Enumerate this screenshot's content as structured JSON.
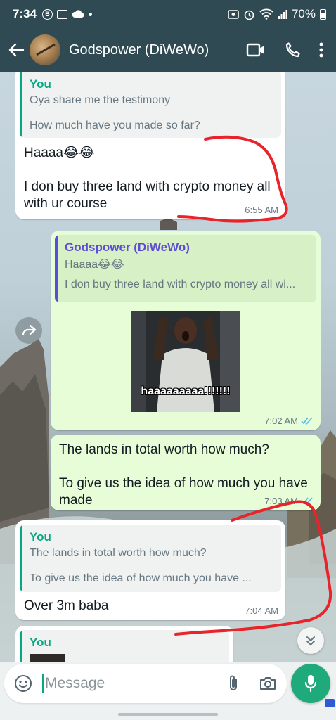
{
  "status_bar": {
    "time": "7:34",
    "b_badge": "B",
    "battery": "70%"
  },
  "header": {
    "contact_name": "Godspower (DiWeWo)",
    "icons": [
      "back-arrow-icon",
      "video-call-icon",
      "voice-call-icon",
      "more-vertical-icon"
    ]
  },
  "messages": [
    {
      "direction": "incoming",
      "quote": {
        "author": "You",
        "lines": [
          "Oya share me the testimony",
          "",
          "How much have you made so far?"
        ]
      },
      "text": "Haaaa😂😂\n\nI don buy three land with crypto money all with ur course",
      "time": "6:55 AM"
    },
    {
      "direction": "outgoing",
      "quote": {
        "author": "Godspower (DiWeWo)",
        "lines": [
          "Haaaa😂😂",
          "",
          "I don buy three land with crypto money all wi..."
        ]
      },
      "sticker_caption": "haaaaaaaaa!!!!!!!",
      "time": "7:02 AM",
      "status": "read"
    },
    {
      "direction": "outgoing",
      "text": "The lands in total worth how much?\n\nTo give us the idea of how much you have made",
      "time": "7:03 AM",
      "status": "read"
    },
    {
      "direction": "incoming",
      "quote": {
        "author": "You",
        "lines": [
          "The lands in total worth how much?",
          "",
          "To give us the idea of how much you have ..."
        ]
      },
      "text": "Over 3m baba",
      "time": "7:04 AM"
    },
    {
      "direction": "incoming",
      "quote": {
        "author": "You"
      }
    }
  ],
  "composer": {
    "placeholder": "Message",
    "icons": [
      "emoji-icon",
      "attach-icon",
      "camera-icon",
      "mic-icon"
    ]
  },
  "colors": {
    "header_bg": "#2f4a52",
    "outgoing_bubble": "#e7fdd7",
    "incoming_bubble": "#ffffff",
    "accent_green": "#06a884",
    "quote_purple": "#5e4bd6",
    "read_ticks": "#53bdeb",
    "annotation_red": "#e8232a"
  }
}
